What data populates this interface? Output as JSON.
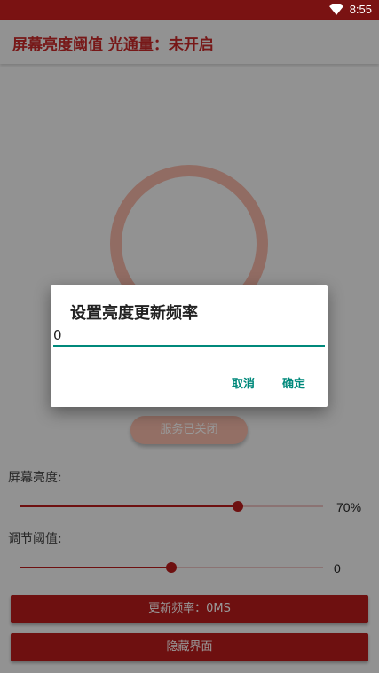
{
  "status_bar": {
    "time": "8:55",
    "wifi_icon": "wifi-icon"
  },
  "app_bar": {
    "title": "屏幕亮度阈值 光通量：未开启"
  },
  "service_button": {
    "label": "服务已关闭"
  },
  "brightness": {
    "label": "屏幕亮度:",
    "value_text": "70%",
    "level": 0.72
  },
  "threshold": {
    "label": "调节阈值:",
    "value_text": "0",
    "level": 0.5
  },
  "buttons": {
    "update_rate": "更新频率：0MS",
    "hide_ui": "隐藏界面"
  },
  "dialog": {
    "title": "设置亮度更新频率",
    "input_value": "0",
    "cancel": "取消",
    "confirm": "确定"
  },
  "colors": {
    "accent": "#b71c1c",
    "status_bar": "#7a1212",
    "dialog_accent": "#00897b"
  }
}
